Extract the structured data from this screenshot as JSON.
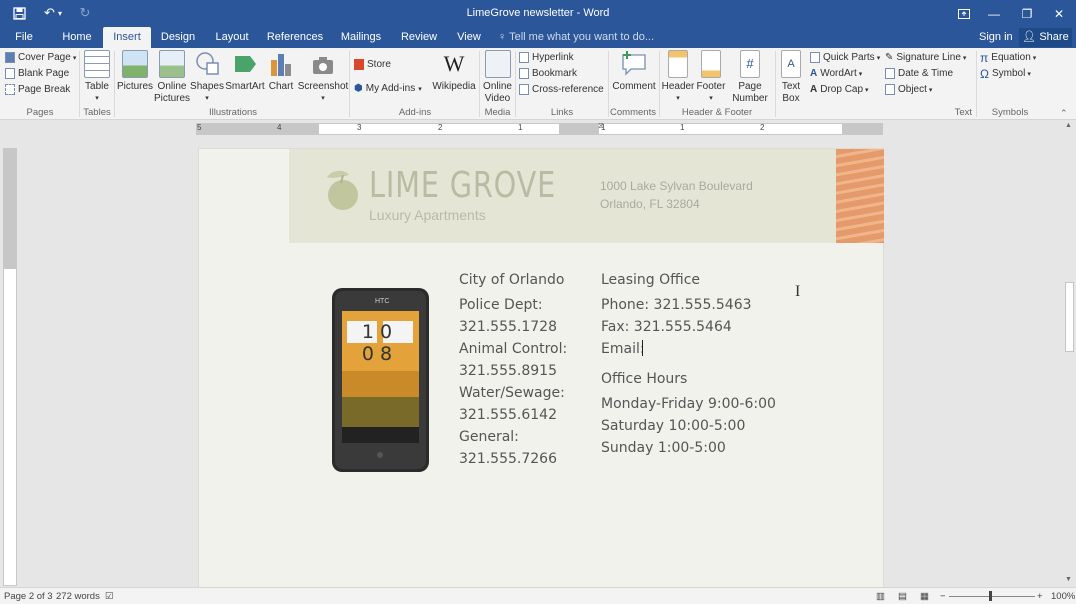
{
  "window": {
    "title": "LimeGrove newsletter - Word",
    "quick_access": [
      "save-icon",
      "undo-icon",
      "redo-icon"
    ]
  },
  "tabs": [
    "File",
    "Home",
    "Insert",
    "Design",
    "Layout",
    "References",
    "Mailings",
    "Review",
    "View"
  ],
  "active_tab": "Insert",
  "tell_me": "Tell me what you want to do...",
  "sign_in": "Sign in",
  "share": "Share",
  "ribbon": {
    "pages": {
      "cover_page": "Cover Page",
      "blank_page": "Blank Page",
      "page_break": "Page Break",
      "label": "Pages"
    },
    "tables": {
      "table": "Table",
      "label": "Tables"
    },
    "illustrations": {
      "pictures": "Pictures",
      "online_pictures_1": "Online",
      "online_pictures_2": "Pictures",
      "shapes": "Shapes",
      "smartart": "SmartArt",
      "chart": "Chart",
      "screenshot": "Screenshot",
      "label": "Illustrations"
    },
    "addins": {
      "store": "Store",
      "my_addins": "My Add-ins",
      "wikipedia": "Wikipedia",
      "label": "Add-ins"
    },
    "media": {
      "online_video_1": "Online",
      "online_video_2": "Video",
      "label": "Media"
    },
    "links": {
      "hyperlink": "Hyperlink",
      "bookmark": "Bookmark",
      "cross_reference": "Cross-reference",
      "label": "Links"
    },
    "comments": {
      "comment": "Comment",
      "label": "Comments"
    },
    "header_footer": {
      "header": "Header",
      "footer": "Footer",
      "page_number_1": "Page",
      "page_number_2": "Number",
      "label": "Header & Footer"
    },
    "text": {
      "text_box_1": "Text",
      "text_box_2": "Box",
      "quick_parts": "Quick Parts",
      "wordart": "WordArt",
      "drop_cap": "Drop Cap",
      "signature_line": "Signature Line",
      "date_time": "Date & Time",
      "object": "Object",
      "label": "Text"
    },
    "symbols": {
      "equation": "Equation",
      "symbol": "Symbol",
      "label": "Symbols"
    }
  },
  "ruler": {
    "numbers": [
      "5",
      "4",
      "3",
      "2",
      "1",
      "1",
      "1",
      "2"
    ]
  },
  "document": {
    "logo_name": "LIME GROVE",
    "logo_tagline": "Luxury Apartments",
    "address_line1": "1000 Lake Sylvan Boulevard",
    "address_line2": "Orlando, FL 32804",
    "phone_screen_time": "10 08",
    "city_heading": "City of Orlando",
    "city_lines": [
      "Police Dept:",
      "321.555.1728",
      "Animal Control:",
      "321.555.8915",
      "Water/Sewage:",
      "321.555.6142",
      "General:",
      "321.555.7266"
    ],
    "leasing_heading": "Leasing Office",
    "leasing_lines": [
      "Phone: 321.555.5463",
      "Fax: 321.555.5464",
      "Email:"
    ],
    "hours_heading": "Office Hours",
    "hours_lines": [
      "Monday-Friday 9:00-6:00",
      "Saturday 10:00-5:00",
      "Sunday 1:00-5:00"
    ]
  },
  "status": {
    "page": "Page 2 of 3",
    "words": "272 words",
    "zoom": "100%"
  },
  "colors": {
    "accent": "#2b579a",
    "page": "#f2f2ec",
    "logo": "#b9bca2"
  }
}
